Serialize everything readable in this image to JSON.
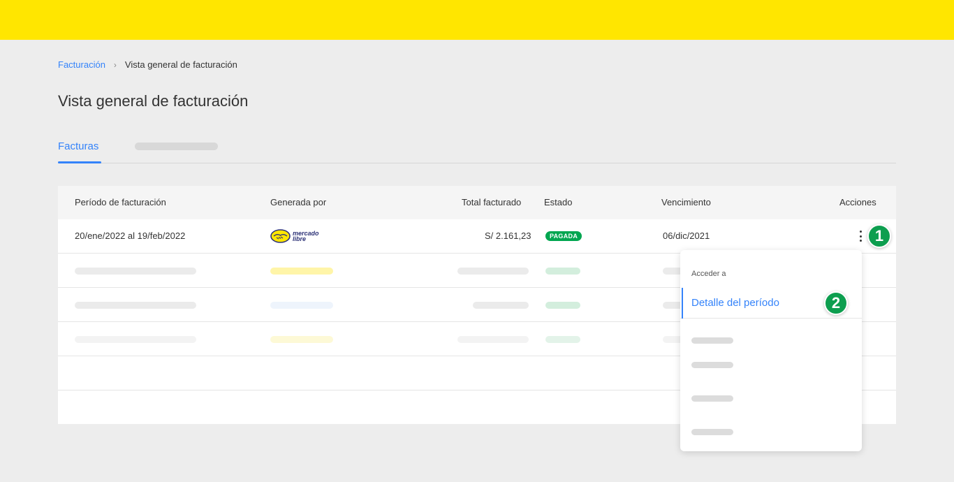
{
  "breadcrumb": {
    "link": "Facturación",
    "separator": "›",
    "current": "Vista general de facturación"
  },
  "page_title": "Vista general de facturación",
  "tabs": {
    "active": "Facturas"
  },
  "table": {
    "headers": [
      "Período de facturación",
      "Generada por",
      "Total facturado",
      "Estado",
      "Vencimiento",
      "Acciones"
    ],
    "rows": [
      {
        "period": "20/ene/2022 al 19/feb/2022",
        "generated_by_logo": "mercado libre",
        "total": "S/ 2.161,23",
        "status": "PAGADA",
        "due": "06/dic/2021"
      }
    ]
  },
  "dropdown": {
    "heading": "Acceder a",
    "item": "Detalle del período"
  },
  "steps": [
    "1",
    "2"
  ],
  "colors": {
    "brand_yellow": "#ffe600",
    "accent_blue": "#3483fa",
    "status_green": "#00a650",
    "step_green": "#0d9e4f"
  },
  "icons": {
    "breadcrumb_sep": "chevron-right-icon",
    "actions": "kebab-menu-icon",
    "logo": "handshake-logo-icon"
  }
}
